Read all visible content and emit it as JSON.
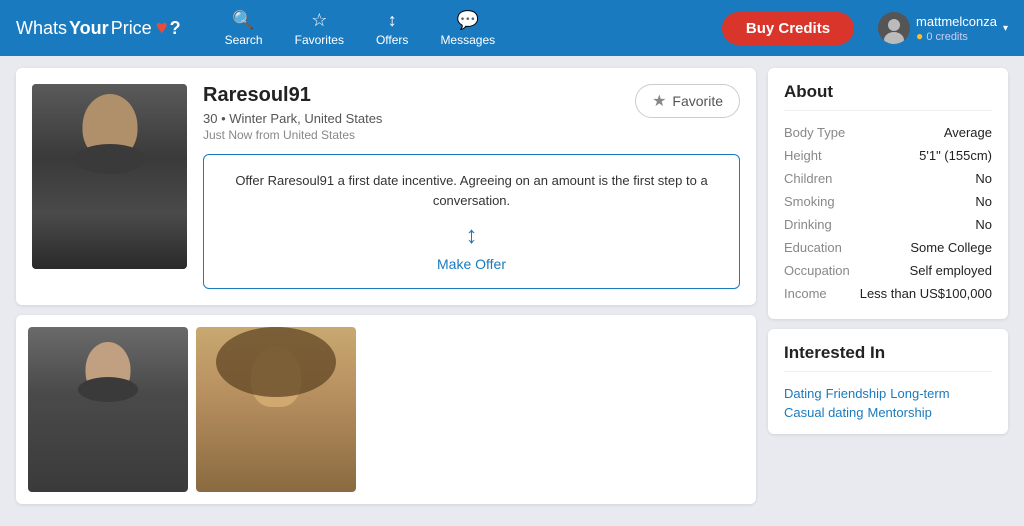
{
  "header": {
    "logo_whats": "Whats",
    "logo_your": "Your",
    "logo_price": "Price",
    "logo_heart": "♥",
    "logo_question": "?",
    "nav": [
      {
        "id": "search",
        "label": "Search",
        "icon": "🔍"
      },
      {
        "id": "favorites",
        "label": "Favorites",
        "icon": "☆"
      },
      {
        "id": "offers",
        "label": "Offers",
        "icon": "↕"
      },
      {
        "id": "messages",
        "label": "Messages",
        "icon": "💬"
      }
    ],
    "buy_credits_label": "Buy Credits",
    "user": {
      "name": "mattmelconza",
      "credits_label": "0 credits",
      "credits_icon": "●"
    }
  },
  "profile": {
    "name": "Raresoul91",
    "age": "30",
    "location": "Winter Park, United States",
    "status": "Just Now from United States",
    "favorite_label": "Favorite",
    "offer_text": "Offer Raresoul91 a first date incentive. Agreeing on an amount is the first step to a conversation.",
    "make_offer_label": "Make Offer",
    "offer_icon": "↕"
  },
  "about": {
    "title": "About",
    "rows": [
      {
        "label": "Body Type",
        "value": "Average"
      },
      {
        "label": "Height",
        "value": "5'1\" (155cm)"
      },
      {
        "label": "Children",
        "value": "No"
      },
      {
        "label": "Smoking",
        "value": "No"
      },
      {
        "label": "Drinking",
        "value": "No"
      },
      {
        "label": "Education",
        "value": "Some College"
      },
      {
        "label": "Occupation",
        "value": "Self employed"
      },
      {
        "label": "Income",
        "value": "Less than US$100,000"
      }
    ]
  },
  "interested_in": {
    "title": "Interested In",
    "tags": [
      "Dating",
      "Friendship",
      "Long-term",
      "Casual dating",
      "Mentorship"
    ]
  }
}
